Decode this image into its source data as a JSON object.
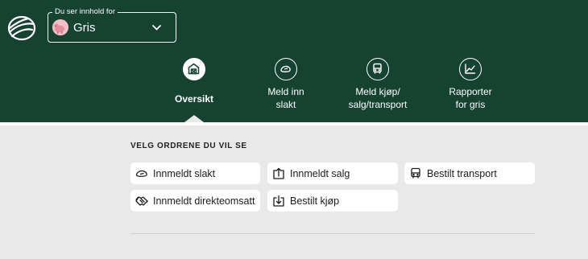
{
  "header": {
    "logo_icon": "field-logo-icon",
    "animal_select": {
      "legend": "Du ser innhold for",
      "value": "Gris",
      "avatar_icon": "pig-avatar-icon",
      "chevron_icon": "chevron-down-icon"
    }
  },
  "nav": {
    "items": [
      {
        "label": "Oversikt",
        "icon": "barn-icon",
        "active": true
      },
      {
        "label": "Meld inn\nslakt",
        "icon": "carcass-icon",
        "active": false
      },
      {
        "label": "Meld kjøp/\nsalg/transport",
        "icon": "truck-icon",
        "active": false
      },
      {
        "label": "Rapporter\nfor gris",
        "icon": "chart-icon",
        "active": false
      }
    ]
  },
  "orders": {
    "title": "VELG ORDRENE DU VIL SE",
    "items": [
      {
        "label": "Innmeldt slakt",
        "icon": "carcass-icon"
      },
      {
        "label": "Innmeldt salg",
        "icon": "box-up-icon"
      },
      {
        "label": "Bestilt transport",
        "icon": "truck-icon"
      },
      {
        "label": "Innmeldt direkteomsatt",
        "icon": "handshake-icon"
      },
      {
        "label": "Bestilt kjøp",
        "icon": "box-down-icon"
      }
    ]
  },
  "colors": {
    "brand_green": "#164232",
    "background": "#e9e9e9",
    "button_bg": "#ffffff"
  }
}
